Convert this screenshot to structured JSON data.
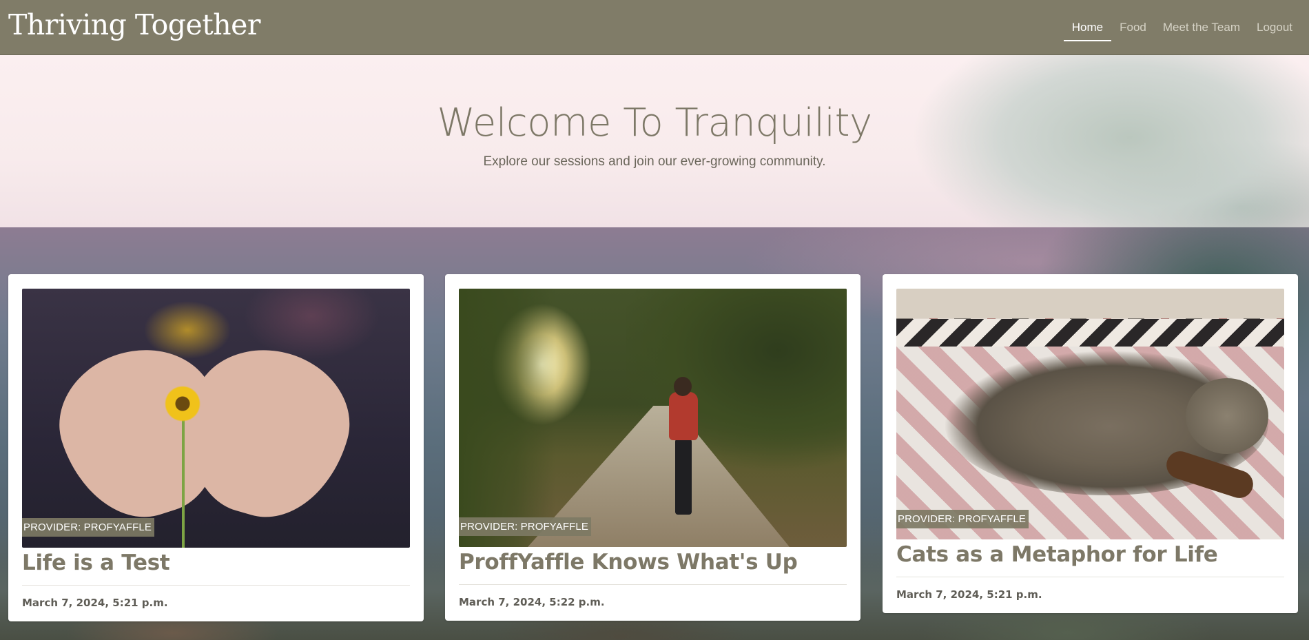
{
  "navbar": {
    "brand": "Thriving Together",
    "links": [
      {
        "label": "Home",
        "active": true
      },
      {
        "label": "Food",
        "active": false
      },
      {
        "label": "Meet the Team",
        "active": false
      },
      {
        "label": "Logout",
        "active": false
      }
    ]
  },
  "hero": {
    "title": "Welcome To Tranquility",
    "subtitle": "Explore our sessions and join our ever-growing community."
  },
  "cards": [
    {
      "badge": "PROVIDER: PROFYAFFLE",
      "title": "Life is a Test",
      "date": "March 7, 2024, 5:21 p.m.",
      "image": "hands-holding-flower"
    },
    {
      "badge": "PROVIDER: PROFYAFFLE",
      "title": "ProffYaffle Knows What's Up",
      "date": "March 7, 2024, 5:22 p.m.",
      "image": "runner-forest-path"
    },
    {
      "badge": "PROVIDER: PROFYAFFLE",
      "title": "Cats as a Metaphor for Life",
      "date": "March 7, 2024, 5:21 p.m.",
      "image": "cat-on-rug"
    }
  ],
  "colors": {
    "navbar": "#807c68",
    "accent_text": "#7d7867",
    "badge": "#7d7964"
  }
}
